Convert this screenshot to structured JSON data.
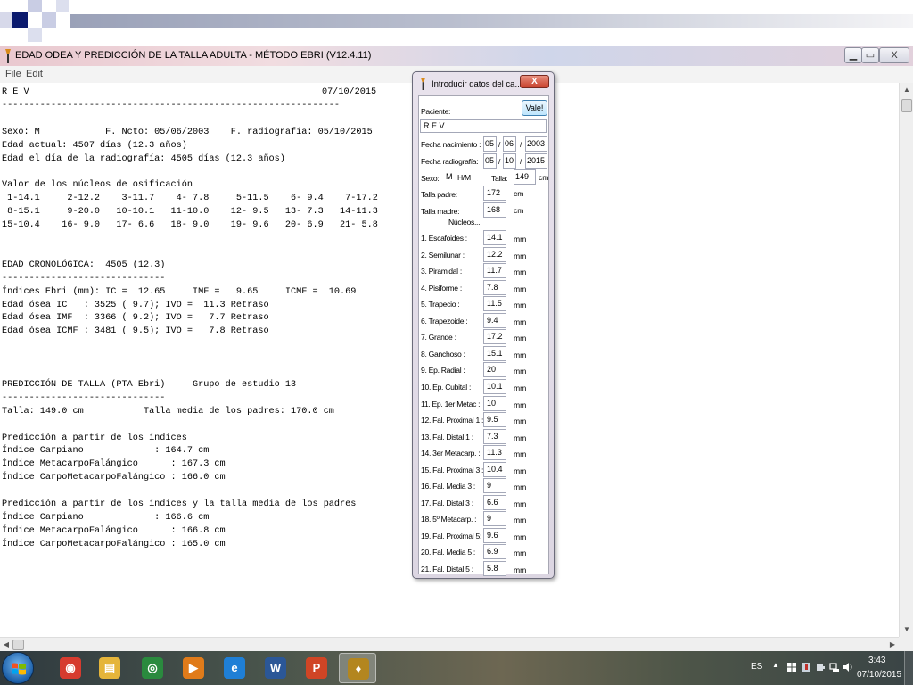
{
  "window": {
    "title": "EDAD ODEA Y PREDICCIÓN DE LA TALLA ADULTA - MÉTODO EBRI (V12.4.11)",
    "minimize_glyph": "▁",
    "maximize_glyph": "▭",
    "close_glyph": "X"
  },
  "menu": {
    "file": "File",
    "edit": "Edit"
  },
  "report": {
    "date": "07/10/2015",
    "text": "R E V\n--------------------------------------------------------------\n\nSexo: M            F. Ncto: 05/06/2003    F. radiografía: 05/10/2015\nEdad actual: 4507 días (12.3 años)\nEdad el día de la radiografía: 4505 días (12.3 años)\n\nValor de los núcleos de osificación\n 1-14.1     2-12.2    3-11.7    4- 7.8     5-11.5    6- 9.4    7-17.2\n 8-15.1     9-20.0   10-10.1   11-10.0    12- 9.5   13- 7.3   14-11.3\n15-10.4    16- 9.0   17- 6.6   18- 9.0    19- 9.6   20- 6.9   21- 5.8\n\n\nEDAD CRONOLÓGICA:  4505 (12.3)\n------------------------------\nÍndices Ebri (mm): IC =  12.65     IMF =   9.65     ICMF =  10.69\nEdad ósea IC   : 3525 ( 9.7); IVO =  11.3 Retraso\nEdad ósea IMF  : 3366 ( 9.2); IVO =   7.7 Retraso\nEdad ósea ICMF : 3481 ( 9.5); IVO =   7.8 Retraso\n\n\n\nPREDICCIÓN DE TALLA (PTA Ebri)     Grupo de estudio 13\n------------------------------\nTalla: 149.0 cm           Talla media de los padres: 170.0 cm\n\nPredicción a partir de los índices\nÍndice Carpiano             : 164.7 cm\nÍndice MetacarpoFalángico      : 167.3 cm\nÍndice CarpoMetacarpoFalángico : 166.0 cm\n\nPredicción a partir de los índices y la talla media de los padres\nÍndice Carpiano             : 166.6 cm\nÍndice MetacarpoFalángico      : 166.8 cm\nÍndice CarpoMetacarpoFalángico : 165.0 cm"
  },
  "dialog": {
    "title": "Introducir datos del ca...",
    "close_glyph": "X",
    "ok_button": "Vale!",
    "patient_label": "Paciente:",
    "patient_value": "R E V",
    "birth_label": "Fecha nacimiento :",
    "birth_day": "05",
    "birth_month": "06",
    "birth_year": "2003",
    "xray_label": "Fecha radiografía:",
    "xray_day": "05",
    "xray_month": "10",
    "xray_year": "2015",
    "date_sep": "/",
    "sex_label": "Sexo:",
    "sex_value": "M",
    "sex_options": "H/M",
    "height_label": "Talla:",
    "height_value": "149",
    "cm_unit": "cm",
    "mm_unit": "mm",
    "father_label": "Talla padre:",
    "father_value": "172",
    "mother_label": "Talla madre:",
    "mother_value": "168",
    "nuclei_header": "Núcleos...",
    "nuclei": [
      {
        "label": "1. Escafoides :",
        "value": "14.1"
      },
      {
        "label": "2. Semilunar :",
        "value": "12.2"
      },
      {
        "label": "3. Piramidal :",
        "value": "11.7"
      },
      {
        "label": "4. Pisiforme :",
        "value": "7.8"
      },
      {
        "label": "5. Trapecio :",
        "value": "11.5"
      },
      {
        "label": "6. Trapezoide :",
        "value": "9.4"
      },
      {
        "label": "7. Grande :",
        "value": "17.2"
      },
      {
        "label": "8. Ganchoso :",
        "value": "15.1"
      },
      {
        "label": "9. Ep. Radial :",
        "value": "20"
      },
      {
        "label": "10. Ep. Cubital :",
        "value": "10.1"
      },
      {
        "label": "11. Ep. 1er Metac :",
        "value": "10"
      },
      {
        "label": "12. Fal. Proximal 1 :",
        "value": "9.5"
      },
      {
        "label": "13. Fal. Distal 1 :",
        "value": "7.3"
      },
      {
        "label": "14. 3er Metacarp. :",
        "value": "11.3"
      },
      {
        "label": "15. Fal. Proximal 3 :",
        "value": "10.4"
      },
      {
        "label": "16. Fal. Media 3 :",
        "value": "9"
      },
      {
        "label": "17. Fal. Distal 3 :",
        "value": "6.6"
      },
      {
        "label": "18. 5º Metacarp. :",
        "value": "9"
      },
      {
        "label": "19. Fal. Proximal 5:",
        "value": "9.6"
      },
      {
        "label": "20. Fal. Media 5 :",
        "value": "6.9"
      },
      {
        "label": "21. Fal. Distal 5 :",
        "value": "5.8"
      }
    ]
  },
  "taskbar": {
    "apps": [
      {
        "name": "chrome-icon",
        "glyph": "◉",
        "color": "#d63b2f"
      },
      {
        "name": "file-explorer-icon",
        "glyph": "▤",
        "color": "#e5b53a"
      },
      {
        "name": "media-center-icon",
        "glyph": "◎",
        "color": "#2a8a3e"
      },
      {
        "name": "media-player-icon",
        "glyph": "▶",
        "color": "#e07b1a"
      },
      {
        "name": "internet-explorer-icon",
        "glyph": "e",
        "color": "#1f7fd6"
      },
      {
        "name": "word-icon",
        "glyph": "W",
        "color": "#2b5797"
      },
      {
        "name": "powerpoint-icon",
        "glyph": "P",
        "color": "#d04525"
      },
      {
        "name": "ebri-app-icon",
        "glyph": "♦",
        "color": "#b3861f"
      }
    ],
    "language": "ES",
    "tray_arrow": "▲",
    "time": "3:43",
    "date": "07/10/2015"
  }
}
